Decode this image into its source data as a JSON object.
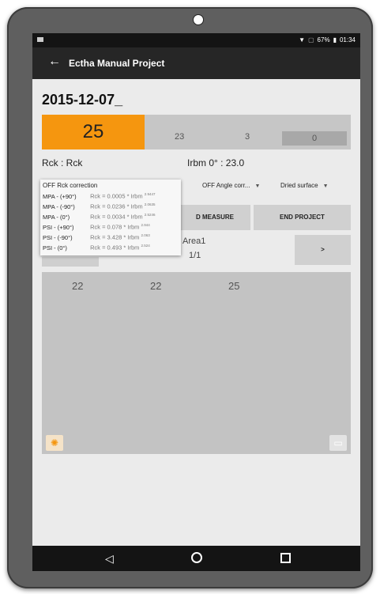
{
  "status": {
    "battery_pct": "67%",
    "time": "01:34",
    "icons": [
      "wifi-icon",
      "no-sim-icon",
      "battery-icon"
    ]
  },
  "appbar": {
    "title": "Ectha Manual Project"
  },
  "main": {
    "date": "2015-12-07_",
    "readings": {
      "current": "25",
      "second": "23",
      "third": "3",
      "fourth": "0"
    },
    "rck_label": "Rck : Rck",
    "irbm_label": "Irbm 0° : 23.0",
    "options": {
      "angle": "OFF Angle corr...",
      "surface": "Dried surface"
    },
    "buttons": {
      "measure": "D MEASURE",
      "end_project": "END PROJECT",
      "next": ">"
    },
    "area": {
      "name": "Area1",
      "count": "1/1"
    },
    "grid_values": [
      "22",
      "22",
      "25"
    ]
  },
  "popup": {
    "header": "OFF Rck correction",
    "rows": [
      {
        "label": "MPA - (+90°)",
        "formula": "Rck = 0.0005 * Irbm",
        "exp": "2.9447"
      },
      {
        "label": "MPA - (-90°)",
        "formula": "Rck = 0.0236 * Irbm",
        "exp": "2.0635"
      },
      {
        "label": "MPA - (0°)",
        "formula": "Rck = 0.0034 * Irbm",
        "exp": "2.5246"
      },
      {
        "label": "PSI - (+90°)",
        "formula": "Rck = 0.078 * Irbm",
        "exp": "2.944"
      },
      {
        "label": "PSI - (-90°)",
        "formula": "Rck = 3.428 * Irbm",
        "exp": "2.063"
      },
      {
        "label": "PSI - (0°)",
        "formula": "Rck = 0.493 * Irbm",
        "exp": "2.524"
      }
    ]
  },
  "colors": {
    "accent": "#f5960f",
    "appbar": "#262626",
    "device": "#5f5f5f"
  }
}
